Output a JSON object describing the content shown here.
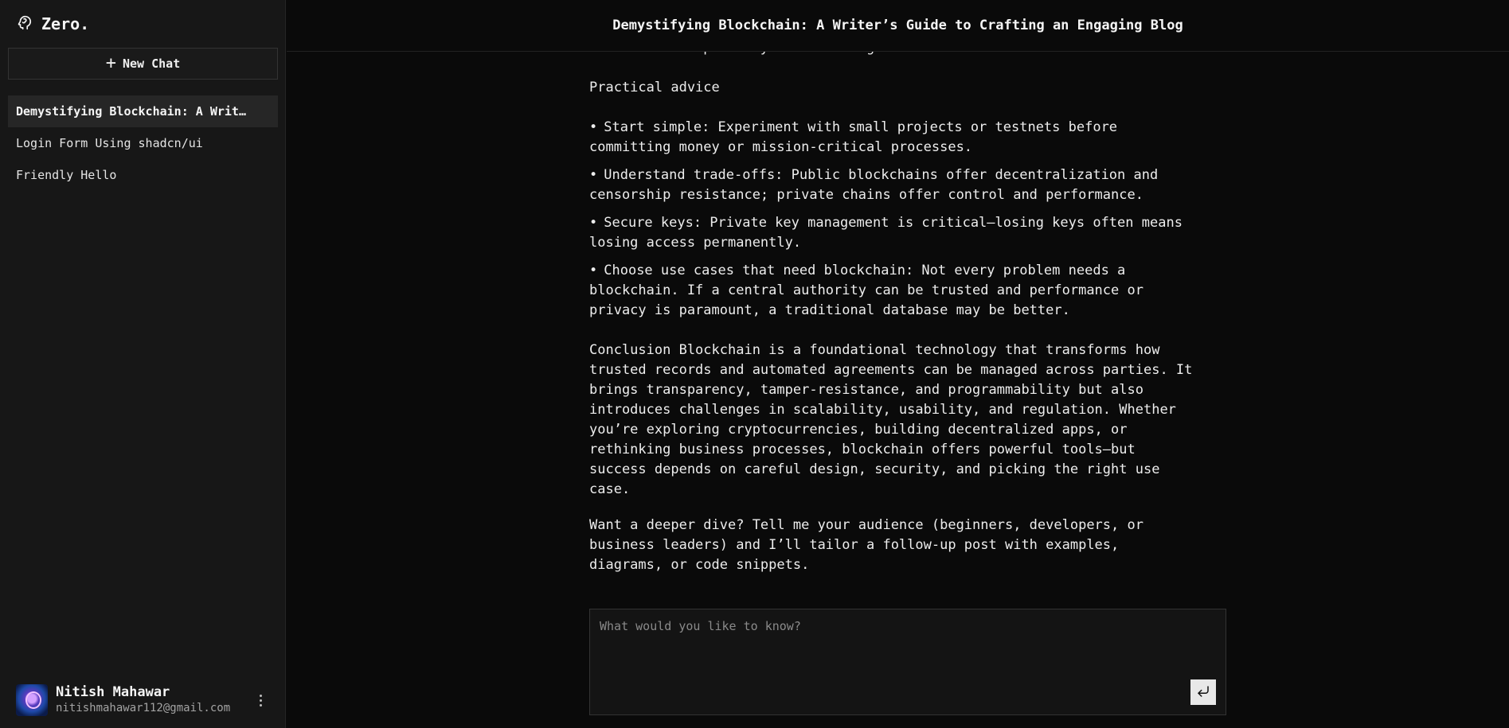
{
  "sidebar": {
    "brand": "Zero.",
    "brand_icon": "brain-head-icon",
    "new_chat_label": "New Chat",
    "chats": [
      {
        "label": "Demystifying Blockchain: A Writer’s Guide to Crafting an Engaging Blog",
        "active": true
      },
      {
        "label": "Login Form Using shadcn/ui",
        "active": false
      },
      {
        "label": "Friendly Hello",
        "active": false
      }
    ],
    "user": {
      "name": "Nitish Mahawar",
      "email": "nitishmahawar112@gmail.com"
    }
  },
  "header": {
    "title": "Demystifying Blockchain: A Writer’s Guide to Crafting an Engaging Blog"
  },
  "message": {
    "intro_tail": "blockchain-inspired systems for digital fiat.",
    "section_heading": "Practical advice",
    "bullets": [
      "Start simple: Experiment with small projects or testnets before committing money or mission-critical processes.",
      "Understand trade-offs: Public blockchains offer decentralization and censorship resistance; private chains offer control and performance.",
      "Secure keys: Private key management is critical—losing keys often means losing access permanently.",
      "Choose use cases that need blockchain: Not every problem needs a blockchain. If a central authority can be trusted and performance or privacy is paramount, a traditional database may be better."
    ],
    "conclusion": "Conclusion Blockchain is a foundational technology that transforms how trusted records and automated agreements can be managed across parties. It brings transparency, tamper-resistance, and programmability but also introduces challenges in scalability, usability, and regulation. Whether you’re exploring cryptocurrencies, building decentralized apps, or rethinking business processes, blockchain offers powerful tools—but success depends on careful design, security, and picking the right use case.",
    "followup": "Want a deeper dive? Tell me your audience (beginners, developers, or business leaders) and I’ll tailor a follow-up post with examples, diagrams, or code snippets."
  },
  "composer": {
    "placeholder": "What would you like to know?",
    "value": ""
  }
}
